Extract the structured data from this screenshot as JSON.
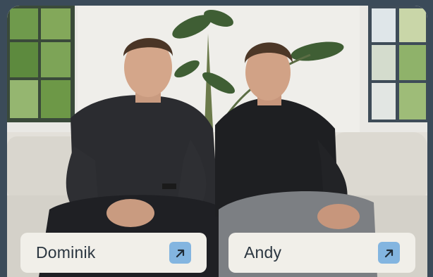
{
  "people": [
    {
      "name": "Dominik",
      "link_icon": "arrow-up-right-icon"
    },
    {
      "name": "Andy",
      "link_icon": "arrow-up-right-icon"
    }
  ],
  "colors": {
    "frame": "#3b4b59",
    "card": "#f1efe9",
    "card_text": "#2b3640",
    "accent": "#83b5e0"
  }
}
